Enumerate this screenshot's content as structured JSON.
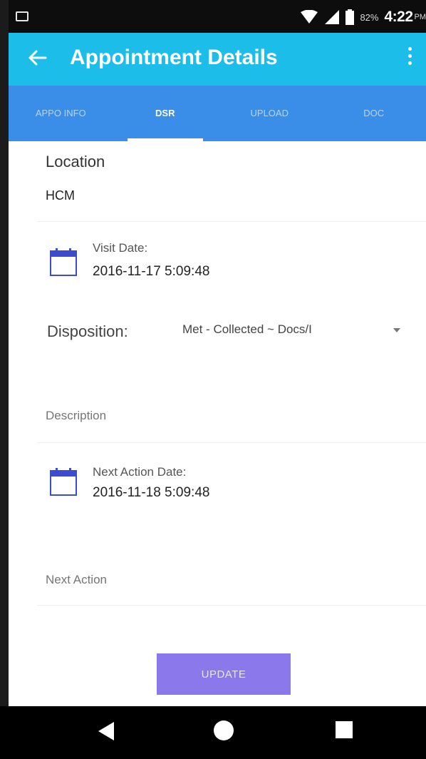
{
  "status_bar": {
    "battery": "82%",
    "time": "4:22",
    "ampm": "PM",
    "icons": [
      "image-notification-icon",
      "wifi-icon",
      "signal-icon",
      "battery-icon"
    ]
  },
  "app_bar": {
    "title": "Appointment Details",
    "back_icon": "arrow-left-icon",
    "menu_icon": "overflow-menu-icon",
    "color": "#1cbde9"
  },
  "tabs": [
    {
      "label": "APPO INFO",
      "active": false
    },
    {
      "label": "DSR",
      "active": true
    },
    {
      "label": "UPLOAD",
      "active": false
    },
    {
      "label": "DOC",
      "active": false
    }
  ],
  "tabs_color": "#3a8ee8",
  "form": {
    "location_label": "Location",
    "location_value": "HCM",
    "visit_date_label": "Visit Date:",
    "visit_date_value": "2016-11-17 5:09:48",
    "disposition_label": "Disposition:",
    "disposition_value": "Met - Collected ~ Docs/I",
    "description_placeholder": "Description",
    "next_action_date_label": "Next Action Date:",
    "next_action_date_value": "2016-11-18 5:09:48",
    "next_action_placeholder": "Next Action"
  },
  "update_label": "UPDATE",
  "update_color": "#8b78ea",
  "nav": {
    "back_icon": "triangle-back-icon",
    "home_icon": "circle-home-icon",
    "recents_icon": "square-recents-icon"
  }
}
